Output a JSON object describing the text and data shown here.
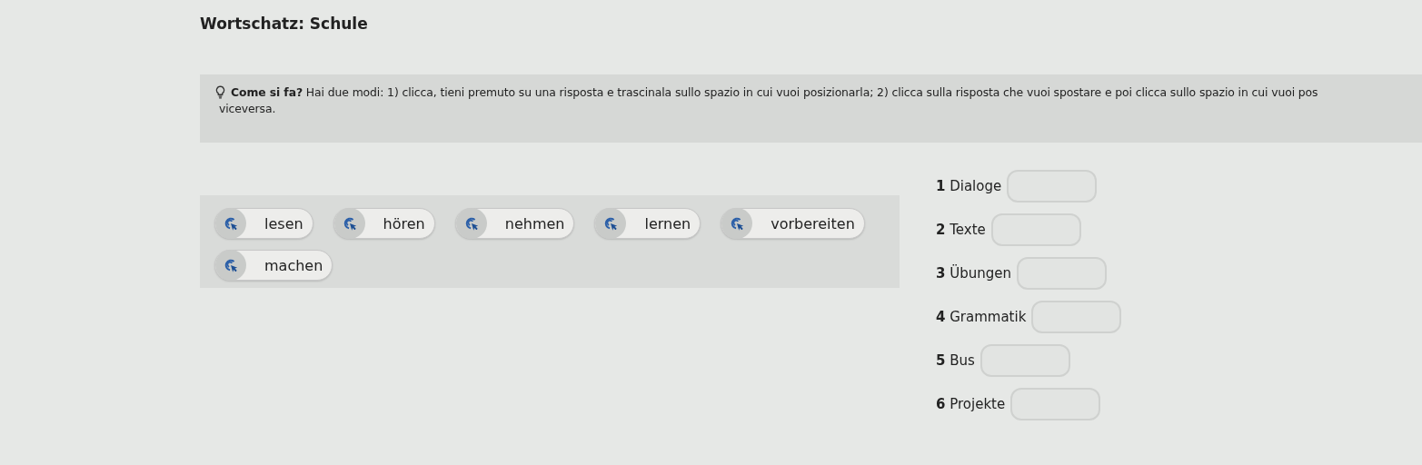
{
  "title": "Wortschatz: Schule",
  "hint": {
    "lines": [
      "**Come si fa?** Hai due modi: 1) clicca, tieni premuto su una risposta e trascinala sullo spazio in cui vuoi posizionarla; 2) clicca sulla risposta che vuoi spostare e poi clicca sullo spazio in cui vuoi pos",
      "viceversa."
    ]
  },
  "answers": [
    {
      "label": "lesen"
    },
    {
      "label": "hören"
    },
    {
      "label": "nehmen"
    },
    {
      "label": "lernen"
    },
    {
      "label": "vorbereiten"
    },
    {
      "label": "machen"
    }
  ],
  "targets": [
    {
      "number": "1",
      "label": "Dialoge"
    },
    {
      "number": "2",
      "label": "Texte"
    },
    {
      "number": "3",
      "label": "Übungen"
    },
    {
      "number": "4",
      "label": "Grammatik"
    },
    {
      "number": "5",
      "label": "Bus"
    },
    {
      "number": "6",
      "label": "Projekte"
    }
  ]
}
